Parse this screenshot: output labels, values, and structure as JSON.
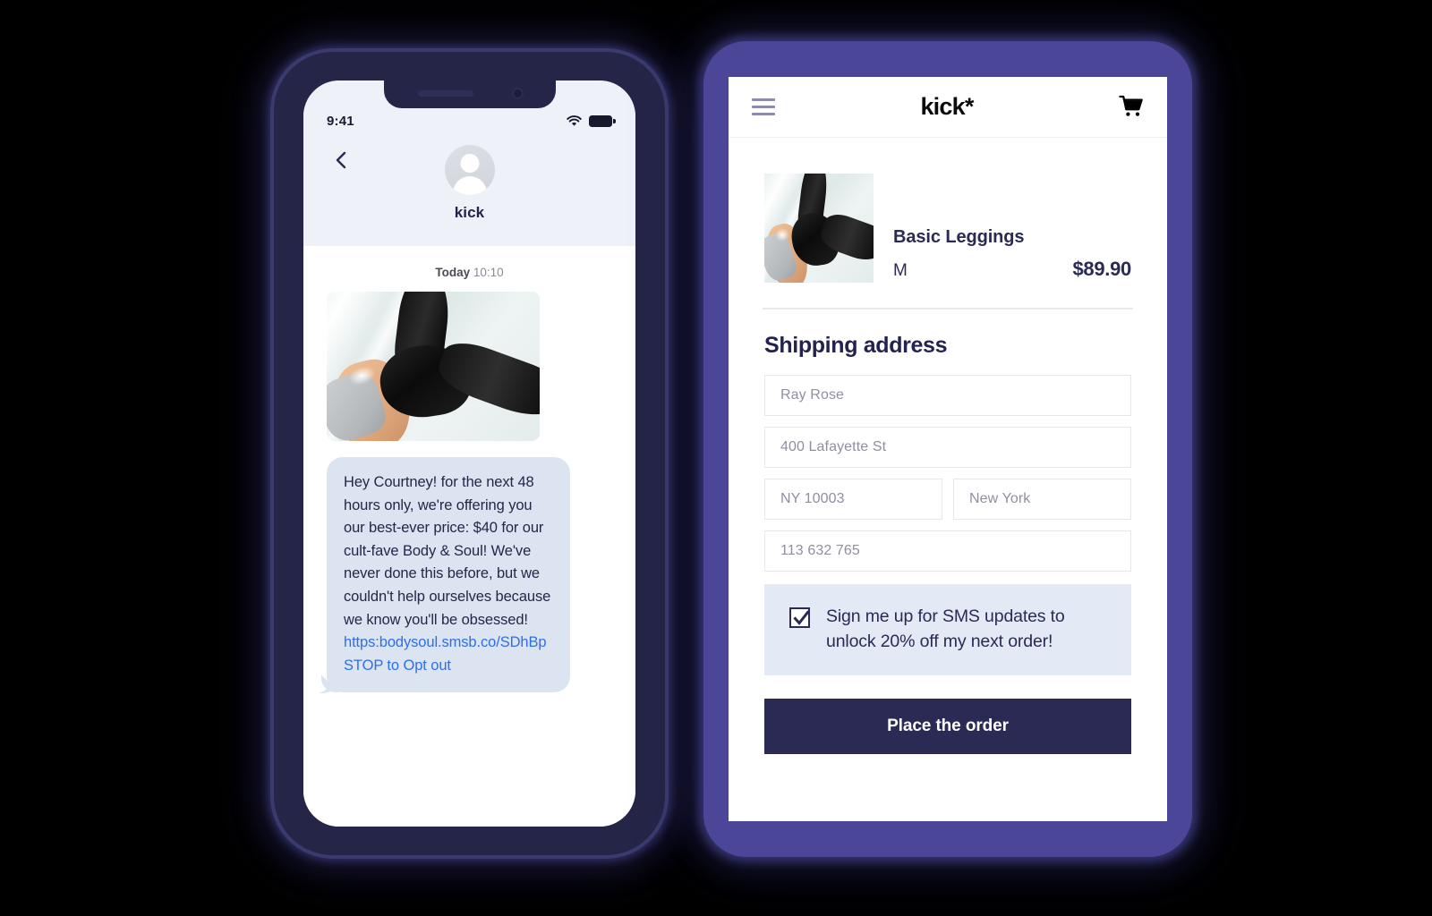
{
  "left_phone": {
    "status_bar": {
      "time": "9:41",
      "wifi_icon": "wifi-icon",
      "battery_icon": "battery-icon"
    },
    "nav": {
      "back_icon": "back-chevron-icon",
      "avatar_icon": "avatar-person-icon",
      "contact_name": "kick"
    },
    "conversation": {
      "day_label": "Today",
      "time_label": "10:10",
      "image_alt": "leggings-product-photo",
      "message_body": "Hey Courtney! for the next 48 hours only, we're offering you our best-ever price: $40 for our cult-fave Body & Soul! We've never done this before, but we couldn't help ourselves because we know you'll be obsessed!",
      "message_link": "https:bodysoul.smsb.co/SDhBp STOP to Opt out"
    }
  },
  "right_phone": {
    "header": {
      "menu_icon": "hamburger-menu-icon",
      "brand": "kick*",
      "cart_icon": "shopping-cart-icon"
    },
    "product": {
      "image_alt": "basic-leggings-thumbnail",
      "name": "Basic Leggings",
      "size": "M",
      "price": "$89.90"
    },
    "shipping": {
      "title": "Shipping address",
      "fields": [
        {
          "name": "full-name",
          "placeholder": "Ray Rose"
        },
        {
          "name": "street-address",
          "placeholder": "400 Lafayette St"
        },
        {
          "name": "zip-code",
          "placeholder": "NY 10003"
        },
        {
          "name": "city",
          "placeholder": "New York"
        },
        {
          "name": "phone-number",
          "placeholder": "113 632 765"
        }
      ]
    },
    "optin": {
      "checked": true,
      "label": "Sign me up for SMS updates to unlock 20% off my next order!"
    },
    "cta": {
      "label": "Place the order"
    }
  },
  "colors": {
    "navy": "#2a2a55",
    "bezel_left": "#252547",
    "bezel_right": "#4b4698",
    "bubble_bg": "#dce4f2",
    "link_blue": "#2f6fe6",
    "optin_bg": "#e4eaf5",
    "chat_header_bg": "#eef1f7",
    "background": "#000000"
  }
}
